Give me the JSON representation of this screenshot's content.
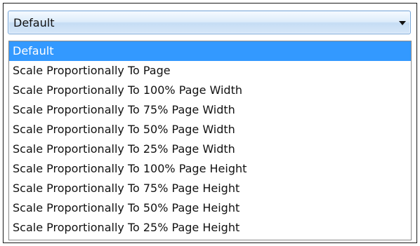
{
  "combo": {
    "value": "Default",
    "arrow_icon": "chevron-down-icon",
    "accent_color": "#3399ff"
  },
  "dropdown": {
    "selected_index": 0,
    "options": [
      "Default",
      "Scale Proportionally To Page",
      "Scale Proportionally To 100% Page Width",
      "Scale Proportionally To 75% Page Width",
      "Scale Proportionally To 50% Page Width",
      "Scale Proportionally To 25% Page Width",
      "Scale Proportionally To 100% Page Height",
      "Scale Proportionally To 75% Page Height",
      "Scale Proportionally To 50% Page Height",
      "Scale Proportionally To 25% Page Height"
    ]
  }
}
